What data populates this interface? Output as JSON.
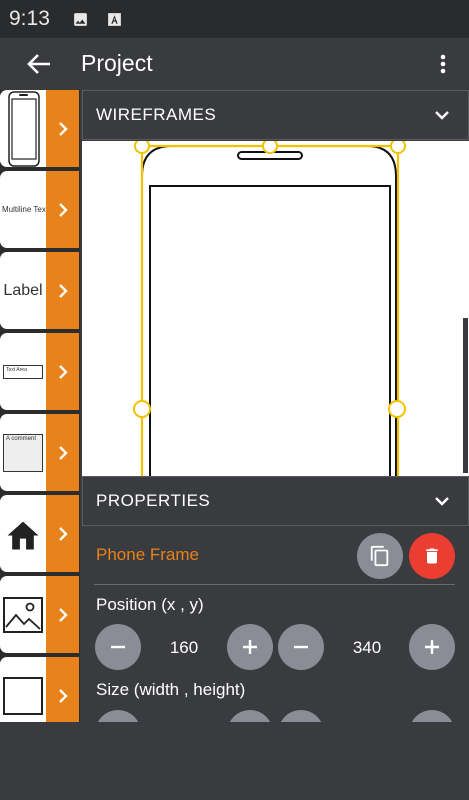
{
  "status_bar": {
    "time": "9:13",
    "icons": [
      "image-icon",
      "a-badge-icon"
    ]
  },
  "app_bar": {
    "title": "Project",
    "back_icon": "arrow-left-icon",
    "menu_icon": "more-vert-icon"
  },
  "palette": {
    "items": [
      {
        "name": "phone",
        "label": ""
      },
      {
        "name": "multiline-text",
        "label": "Multiline Text"
      },
      {
        "name": "label",
        "label": "Label"
      },
      {
        "name": "text-area",
        "label": "Text Area"
      },
      {
        "name": "comment",
        "label": "A comment"
      },
      {
        "name": "home-icon",
        "label": ""
      },
      {
        "name": "image",
        "label": ""
      },
      {
        "name": "box",
        "label": ""
      }
    ],
    "arrow_icon": "chevron-right-icon"
  },
  "wireframes": {
    "title": "WIREFRAMES"
  },
  "properties": {
    "title": "PROPERTIES",
    "element_name": "Phone Frame",
    "position_label": "Position (x , y)",
    "x": "160",
    "y": "340",
    "size_label": "Size (width , height)"
  },
  "colors": {
    "accent": "#e8821a",
    "delete": "#ea3e32",
    "selection": "#f2c200",
    "background": "#3a3b3e"
  }
}
